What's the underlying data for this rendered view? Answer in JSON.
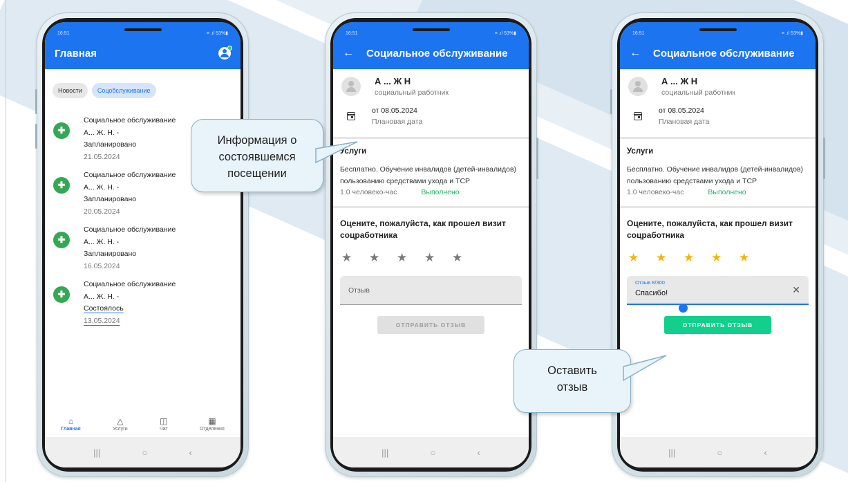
{
  "phones": [
    {
      "status_time": "16:51",
      "status_icons": "≡ .ıl 53%▮",
      "title": "Главная",
      "chips": [
        "Новости",
        "Соцобслуживание"
      ],
      "feed": [
        {
          "title": "Социальное обслуживание",
          "person": "А... Ж. Н. -",
          "status": "Запланировано",
          "date": "21.05.2024"
        },
        {
          "title": "Социальное обслуживание",
          "person": "А... Ж. Н. -",
          "status": "Запланировано",
          "date": "20.05.2024"
        },
        {
          "title": "Социальное обслуживание",
          "person": "А... Ж. Н. -",
          "status": "Запланировано",
          "date": "16.05.2024"
        },
        {
          "title": "Социальное обслуживание",
          "person": "А... Ж. Н. -",
          "status": "Состоялось",
          "date": "13.05.2024"
        }
      ],
      "nav": [
        {
          "label": "Главная",
          "icon": "home-icon",
          "glyph": "⌂"
        },
        {
          "label": "Услуги",
          "icon": "shapes-icon",
          "glyph": "△"
        },
        {
          "label": "Чат",
          "icon": "chat-icon",
          "glyph": "…"
        },
        {
          "label": "Отделения",
          "icon": "map-icon",
          "glyph": "▥"
        }
      ]
    },
    {
      "status_time": "16:51",
      "status_icons": "≡ .ıl 53%▮",
      "title": "Социальное обслуживание",
      "worker_name": "А ... Ж Н",
      "worker_role": "социальный работник",
      "date_value": "от 08.05.2024",
      "date_label": "Плановая дата",
      "services_title": "Услуги",
      "service_text": "Бесплатно. Обучение инвалидов (детей-инвалидов) пользованию средствами ухода и ТСР",
      "service_amount": "1.0 человеко-час",
      "service_status": "Выполнено",
      "rate_title": "Оцените, пожалуйста, как прошел визит соцработника",
      "stars_total": 5,
      "stars_selected": 0,
      "review_placeholder": "Отзыв",
      "submit_label": "ОТПРАВИТЬ ОТЗЫВ"
    },
    {
      "status_time": "16:51",
      "status_icons": "≡ .ıl 53%▮",
      "title": "Социальное обслуживание",
      "worker_name": "А ... Ж Н",
      "worker_role": "социальный работник",
      "date_value": "от 08.05.2024",
      "date_label": "Плановая дата",
      "services_title": "Услуги",
      "service_text": "Бесплатно. Обучение инвалидов (детей-инвалидов) пользованию средствами ухода и ТСР",
      "service_amount": "1.0 человеко-час",
      "service_status": "Выполнено",
      "rate_title": "Оцените, пожалуйста, как прошел визит соцработника",
      "stars_total": 5,
      "stars_selected": 5,
      "review_label": "Отзыв 8/300",
      "review_value": "Спасибо!",
      "submit_label": "ОТПРАВИТЬ ОТЗЫВ"
    }
  ],
  "callouts": [
    {
      "text_lines": [
        "Информация о",
        "состоявшемся",
        "посещении"
      ]
    },
    {
      "text_lines": [
        "Оставить",
        "отзыв"
      ]
    }
  ],
  "colors": {
    "primary": "#1d74f0",
    "success": "#22b36b",
    "submit_active": "#12d08b",
    "star": "#f7b500",
    "feed_icon": "#34a853"
  }
}
